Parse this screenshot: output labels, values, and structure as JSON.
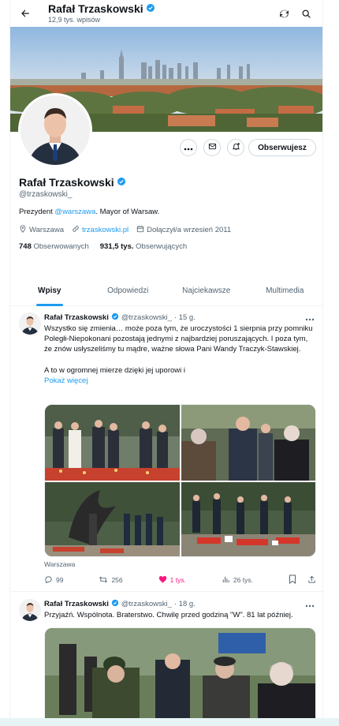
{
  "header": {
    "title": "Rafał Trzaskowski",
    "subtitle": "12,9 tys. wpisów"
  },
  "profile": {
    "name": "Rafał Trzaskowski",
    "handle": "@trzaskowski_",
    "bio_prefix": "Prezydent ",
    "bio_mention": "@warszawa",
    "bio_suffix": ". Mayor of Warsaw.",
    "location": "Warszawa",
    "website": "trzaskowski.pl",
    "joined": "Dołączył/a wrzesień 2011",
    "following_count": "748",
    "following_label": "Obserwowanych",
    "followers_count": "931,5 tys.",
    "followers_label": "Obserwujących",
    "follow_button": "Obserwujesz"
  },
  "tabs": [
    "Wpisy",
    "Odpowiedzi",
    "Najciekawsze",
    "Multimedia"
  ],
  "tweets": [
    {
      "name": "Rafał Trzaskowski",
      "handle": "@trzaskowski_",
      "time": "· 15 g.",
      "text": "Wszystko się zmienia… może poza tym, że uroczystości 1 sierpnia przy pomniku Poległi-Niepokonani pozostają jednymi z najbardziej poruszających. I poza tym, że znów usłyszeliśmy tu mądre, ważne słowa Pani Wandy Traczyk-Stawskiej.\n\nA to w ogromnej mierze dzięki jej uporowi i",
      "show_more": "Pokaż więcej",
      "place": "Warszawa",
      "replies": "99",
      "reposts": "256",
      "likes": "1 tys.",
      "views": "26 tys."
    },
    {
      "name": "Rafał Trzaskowski",
      "handle": "@trzaskowski_",
      "time": "· 18 g.",
      "text": "Przyjaźń. Wspólnota. Braterstwo. Chwilę przed godziną \"W\". 81 lat później."
    }
  ],
  "colors": {
    "accent": "#1d9bf0",
    "like": "#f91880",
    "verified": "#1d9bf0"
  }
}
